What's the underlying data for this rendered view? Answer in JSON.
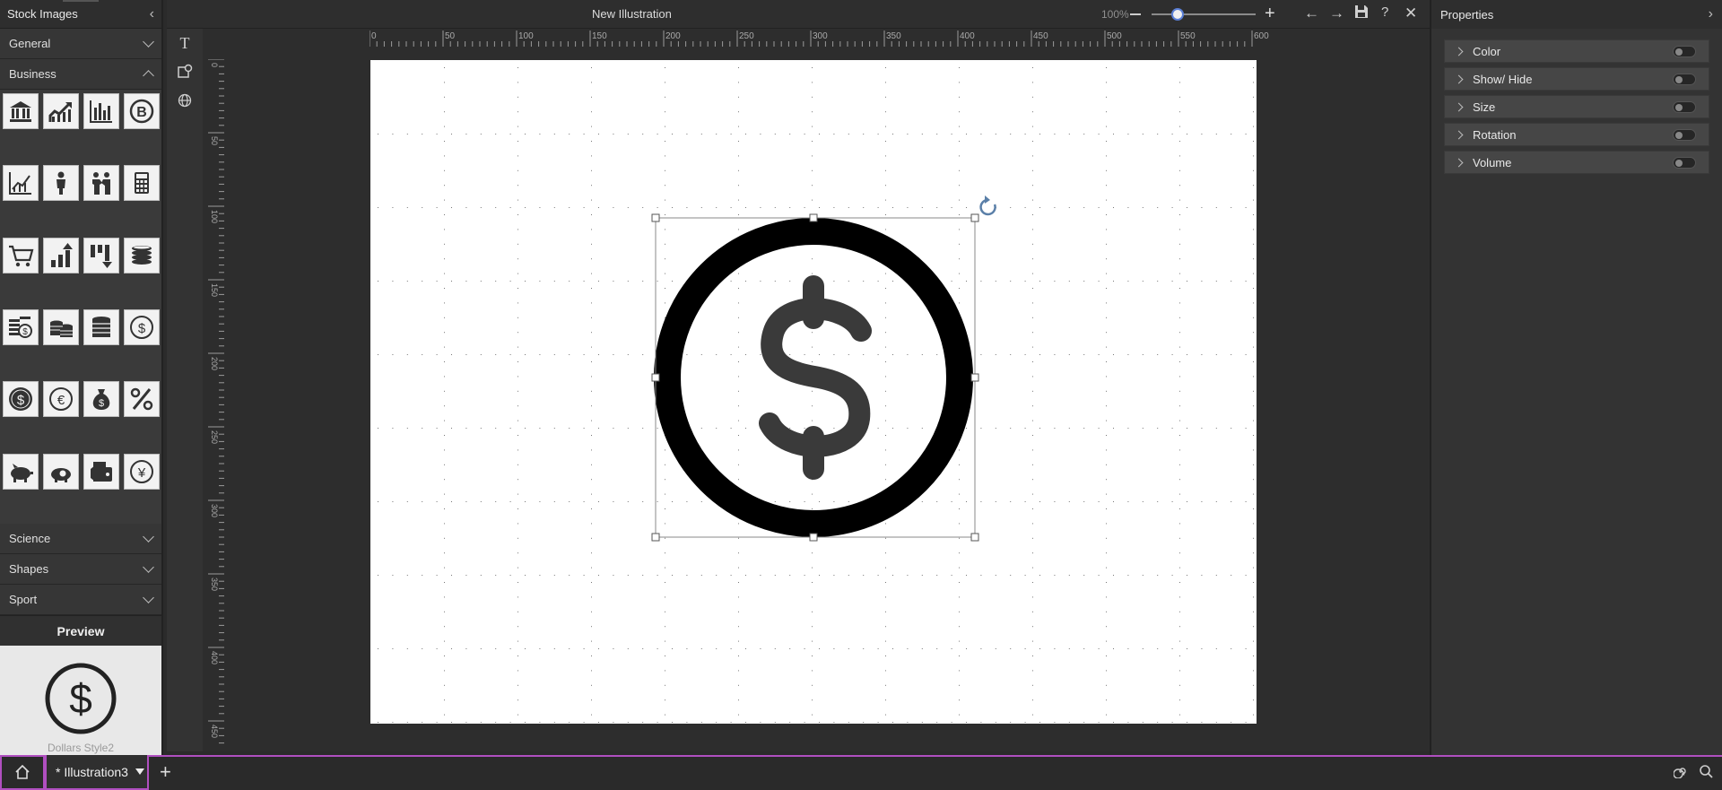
{
  "left_panel": {
    "title": "Stock Images",
    "categories_top": [
      {
        "label": "General",
        "expanded": false
      },
      {
        "label": "Business",
        "expanded": true
      }
    ],
    "categories_bottom": [
      {
        "label": "Science"
      },
      {
        "label": "Shapes"
      },
      {
        "label": "Sport"
      }
    ],
    "business_icons": [
      "bank-icon",
      "growth-chart-icon",
      "bar-chart-icon",
      "bitcoin-icon",
      "line-chart-icon",
      "businessman-icon",
      "handshake-icon",
      "calculator-icon",
      "cart-icon",
      "bars-up-icon",
      "bars-down-icon",
      "coin-stack-icon",
      "money-stack-icon",
      "coins-icon",
      "coin-pile-icon",
      "dollar-circle-icon",
      "dollar-filled-icon",
      "euro-icon",
      "money-bag-icon",
      "percent-icon",
      "piggy-bank-icon",
      "piggy-coin-icon",
      "wallet-icon",
      "yen-icon"
    ],
    "preview": {
      "title": "Preview",
      "name": "Dollars Style2"
    }
  },
  "toolbar": {
    "document_title": "New Illustration",
    "zoom_label": "100%",
    "zoom_level": 0.25
  },
  "rulers": {
    "top": [
      "0",
      "50",
      "100",
      "150",
      "200",
      "250",
      "300",
      "350",
      "400",
      "450",
      "500",
      "550",
      "600"
    ],
    "left": [
      "0",
      "50",
      "100",
      "150",
      "200",
      "250",
      "300",
      "350",
      "400",
      "450"
    ]
  },
  "properties": {
    "title": "Properties",
    "items": [
      {
        "label": "Color"
      },
      {
        "label": "Show/ Hide"
      },
      {
        "label": "Size"
      },
      {
        "label": "Rotation"
      },
      {
        "label": "Volume"
      }
    ]
  },
  "bottom": {
    "tab_label": "* Illustration3"
  },
  "colors": {
    "accent": "#b04fc0",
    "icon_dark": "#333333"
  }
}
